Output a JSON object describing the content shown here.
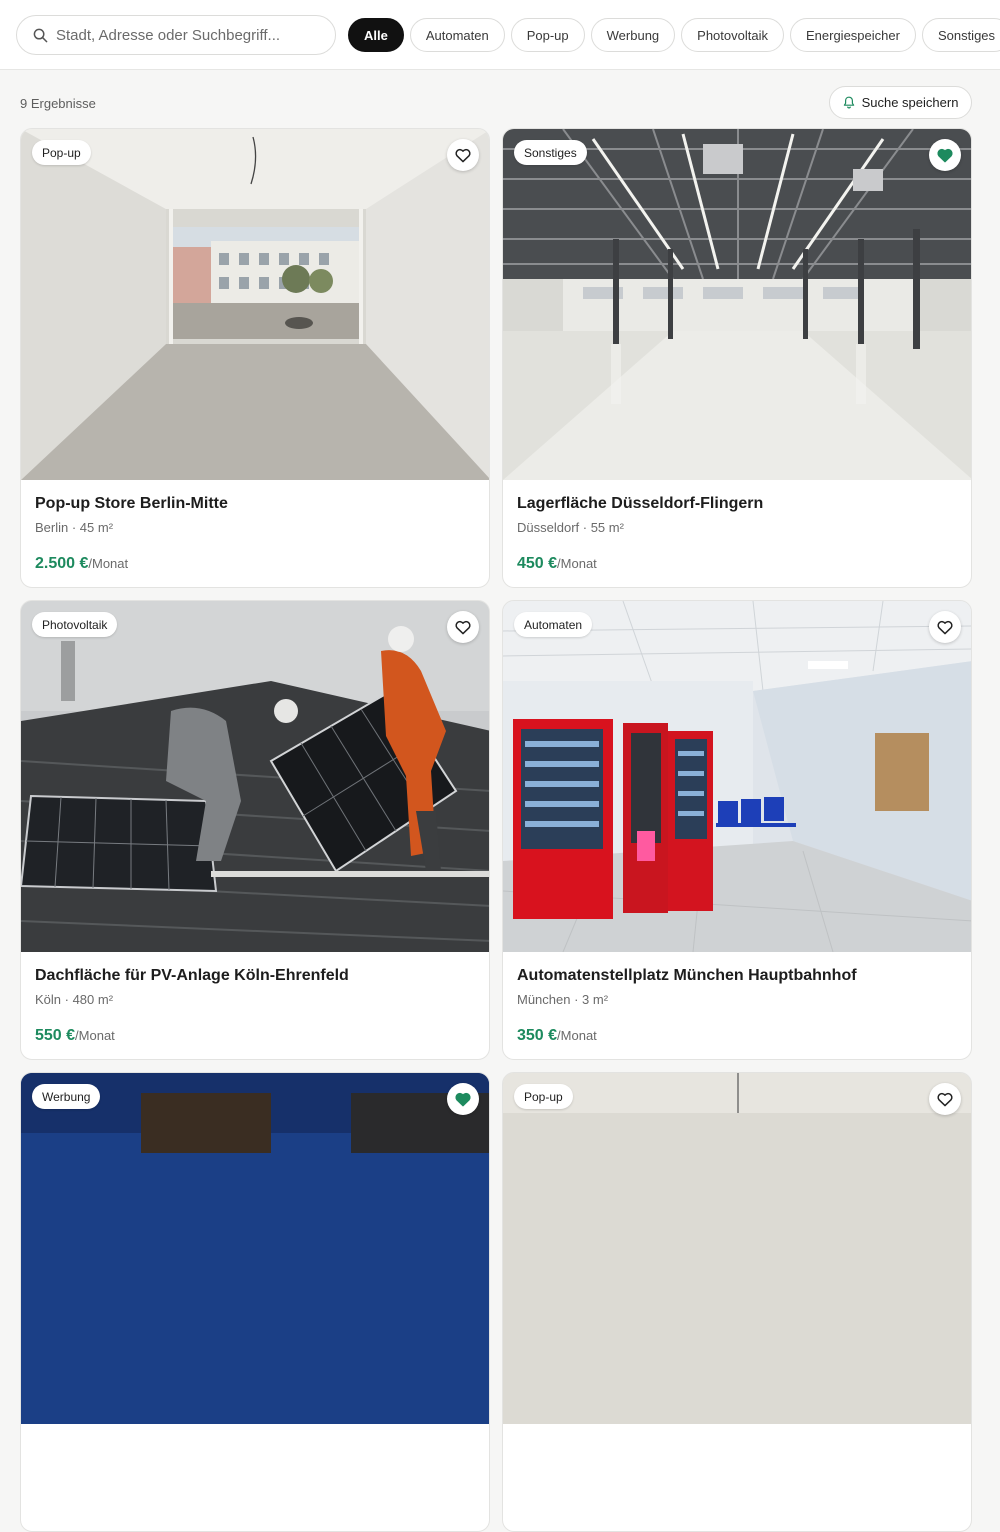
{
  "search": {
    "placeholder": "Stadt, Adresse oder Suchbegriff..."
  },
  "filters": [
    {
      "label": "Alle",
      "active": true
    },
    {
      "label": "Automaten"
    },
    {
      "label": "Pop-up"
    },
    {
      "label": "Werbung"
    },
    {
      "label": "Photovoltaik"
    },
    {
      "label": "Energiespeicher"
    },
    {
      "label": "Sonstiges"
    }
  ],
  "results_count": "9 Ergebnisse",
  "save_search_label": "Suche speichern",
  "accent_color": "#1d8a5e",
  "listings": [
    {
      "badge": "Pop-up",
      "favorited": false,
      "title": "Pop-up Store Berlin-Mitte",
      "meta": "Berlin · 45 m²",
      "price": "2.500 €",
      "price_unit": "/Monat"
    },
    {
      "badge": "Sonstiges",
      "favorited": true,
      "title": "Lagerfläche Düsseldorf-Flingern",
      "meta": "Düsseldorf · 55 m²",
      "price": "450 €",
      "price_unit": "/Monat"
    },
    {
      "badge": "Photovoltaik",
      "favorited": false,
      "title": "Dachfläche für PV-Anlage Köln-Ehrenfeld",
      "meta": "Köln · 480 m²",
      "price": "550 €",
      "price_unit": "/Monat"
    },
    {
      "badge": "Automaten",
      "favorited": false,
      "title": "Automatenstellplatz München Hauptbahnhof",
      "meta": "München · 3 m²",
      "price": "350 €",
      "price_unit": "/Monat"
    },
    {
      "badge": "Werbung",
      "favorited": true
    },
    {
      "badge": "Pop-up",
      "favorited": false
    }
  ]
}
